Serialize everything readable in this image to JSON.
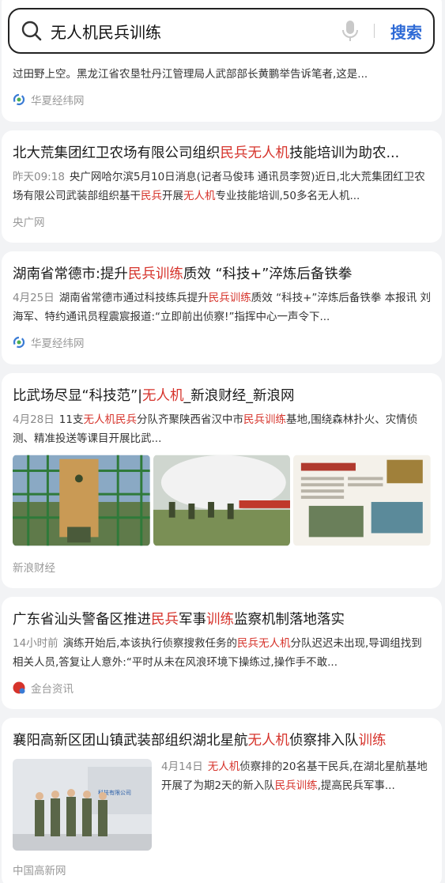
{
  "search": {
    "query": "无人机民兵训练",
    "button_label": "搜索"
  },
  "results": [
    {
      "snippet": "过田野上空。黑龙江省农垦牡丹江管理局人武部部长黄鹏举告诉笔者,这是...",
      "source": "华夏经纬网",
      "source_icon": "swirl-logo-icon"
    },
    {
      "title_parts": [
        "北大荒集团红卫农场有限公司组织",
        "民兵无人机",
        "技能培训为助农..."
      ],
      "time": "昨天09:18",
      "snippet_parts": [
        "央广网哈尔滨5月10日消息(记者马俊玮 通讯员李贺)近日,北大荒集团红卫农场有限公司武装部组织基干",
        "民兵",
        "开展",
        "无人机",
        "专业技能培训,50多名无人机..."
      ],
      "source": "央广网"
    },
    {
      "title_parts": [
        "湖南省常德市:提升",
        "民兵训练",
        "质效 “科技+”淬炼后备铁拳"
      ],
      "time": "4月25日",
      "snippet_parts": [
        "湖南省常德市通过科技练兵提升",
        "民兵训练",
        "质效 “科技+”淬炼后备铁拳 本报讯 刘海军、特约通讯员程震宸报道:“立即前出侦察!”指挥中心一声令下..."
      ],
      "source": "华夏经纬网",
      "source_icon": "swirl-logo-icon"
    },
    {
      "title_parts": [
        "比武场尽显“科技范”|",
        "无人机",
        "_新浪财经_新浪网"
      ],
      "time": "4月28日",
      "snippet_parts": [
        "11支",
        "无人机民兵",
        "分队齐聚陕西省汉中市",
        "民兵训练",
        "基地,围绕森林扑火、灾情侦测、精准投送等课目开展比武..."
      ],
      "images": [
        "climbing-wall-photo",
        "smoke-drill-photo",
        "newspaper-page-photo"
      ],
      "source": "新浪财经"
    },
    {
      "title_parts": [
        "广东省汕头警备区推进",
        "民兵",
        "军事",
        "训练",
        "监察机制落地落实"
      ],
      "time": "14小时前",
      "snippet_parts": [
        "演练开始后,本该执行侦察搜救任务的",
        "民兵无人机",
        "分队迟迟未出现,导调组找到相关人员,答复让人意外:“平时从未在风浪环境下操练过,操作手不敢..."
      ],
      "source": "金台资讯",
      "source_icon": "jintai-logo-icon"
    },
    {
      "title_parts": [
        "襄阳高新区团山镇武装部组织湖北星航",
        "无人机",
        "侦察排入队",
        "训练"
      ],
      "time": "4月14日",
      "snippet_parts": [
        "无人机",
        "侦察排的20名基干民兵,在湖北星航基地开展了为期2天的新入队",
        "民兵训练",
        ",提高民兵军事..."
      ],
      "image": "soldiers-saluting-photo",
      "source": "中国高新网"
    }
  ],
  "colors": {
    "highlight": "#d6332b",
    "search_button": "#2f6bd6"
  }
}
